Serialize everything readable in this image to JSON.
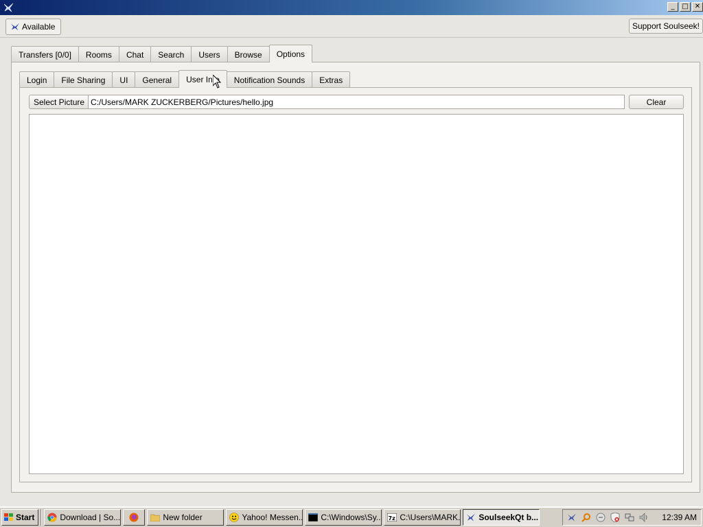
{
  "window": {
    "title": ""
  },
  "toolbar": {
    "status_label": "Available",
    "support_label": "Support Soulseek!"
  },
  "main_tabs": [
    "Transfers [0/0]",
    "Rooms",
    "Chat",
    "Search",
    "Users",
    "Browse",
    "Options"
  ],
  "active_main_tab": "Options",
  "sub_tabs": [
    "Login",
    "File Sharing",
    "UI",
    "General",
    "User Info",
    "Notification Sounds",
    "Extras"
  ],
  "active_sub_tab": "User Info",
  "user_info": {
    "select_picture_label": "Select Picture",
    "picture_path": "C:/Users/MARK ZUCKERBERG/Pictures/hello.jpg",
    "clear_label": "Clear",
    "description": ""
  },
  "taskbar": {
    "start_label": "Start",
    "tasks": [
      {
        "label": "Download | So...",
        "icon": "chrome-icon"
      },
      {
        "label": "",
        "icon": "firefox-icon"
      },
      {
        "label": "New folder",
        "icon": "folder-icon"
      },
      {
        "label": "Yahoo! Messen...",
        "icon": "yahoo-messenger-icon"
      },
      {
        "label": "C:\\Windows\\Sy...",
        "icon": "cmd-icon"
      },
      {
        "label": "C:\\Users\\MARK...",
        "icon": "7zip-icon"
      },
      {
        "label": "SoulseekQt b...",
        "icon": "soulseek-icon"
      }
    ],
    "clock": "12:39 AM"
  },
  "colors": {
    "titlebar_start": "#0a246a",
    "titlebar_end": "#a6caf0",
    "panel_bg": "#f2f1ee",
    "taskbar_bg": "#d4d0c8"
  }
}
